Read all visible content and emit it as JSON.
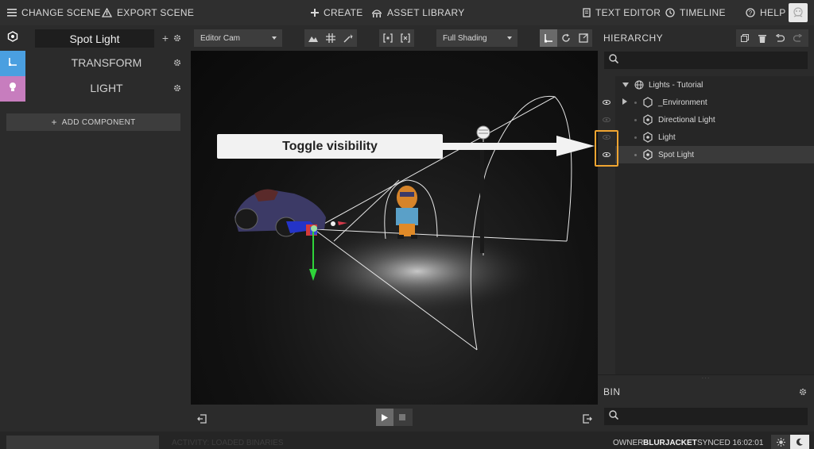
{
  "topbar": {
    "change_scene": "CHANGE SCENE",
    "export_scene": "EXPORT SCENE",
    "create": "CREATE",
    "asset_library": "ASSET LIBRARY",
    "text_editor": "TEXT EDITOR",
    "timeline": "TIMELINE",
    "help": "HELP"
  },
  "inspector": {
    "title": "Spot Light",
    "components": [
      "TRANSFORM",
      "LIGHT"
    ],
    "add_component": "ADD COMPONENT",
    "tab_colors": {
      "object": "#2b2b2b",
      "transform": "#4a9fe0",
      "light": "#c77dbe"
    }
  },
  "viewport_toolbar": {
    "camera": "Editor Cam",
    "shading": "Full Shading"
  },
  "annotation": {
    "callout": "Toggle visibility",
    "highlight_color": "#f0a531"
  },
  "hierarchy": {
    "title": "HIERARCHY",
    "root": "Lights - Tutorial",
    "items": [
      "_Environment",
      "Directional Light",
      "Light",
      "Spot Light"
    ]
  },
  "bin": {
    "title": "BIN"
  },
  "status": {
    "activity": "ACTIVITY: LOADED BINARIES",
    "owner_label": "OWNER",
    "owner": "BLURJACKET",
    "synced": "SYNCED 16:02:01"
  }
}
